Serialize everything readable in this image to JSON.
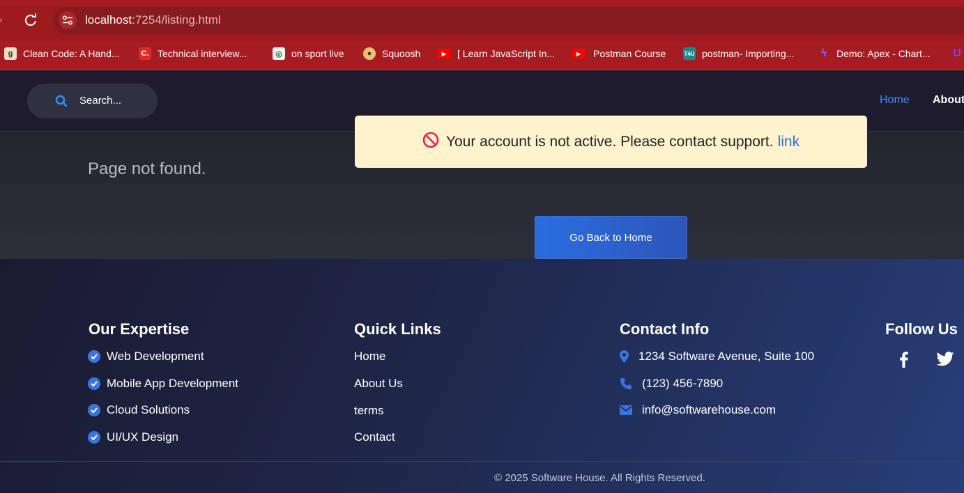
{
  "browser": {
    "url_host": "localhost",
    "url_path": ":7254/listing.html",
    "bookmarks": [
      {
        "label": "Clean Code: A Hand...",
        "icon": "goodreads-icon"
      },
      {
        "label": "Technical interview...",
        "icon": "c-icon"
      },
      {
        "label": "on sport live",
        "icon": "sport-icon"
      },
      {
        "label": "Squoosh",
        "icon": "squoosh-icon"
      },
      {
        "label": "[ Learn JavaScript In...",
        "icon": "youtube-icon"
      },
      {
        "label": "Postman Course",
        "icon": "youtube-icon"
      },
      {
        "label": "postman- Importing...",
        "icon": "t4u-icon"
      },
      {
        "label": "Demo: Apex - Chart...",
        "icon": "apex-icon"
      }
    ]
  },
  "header": {
    "search_placeholder": "Search...",
    "nav": {
      "home": "Home",
      "about": "About"
    },
    "accent_color": "#3f8ff5"
  },
  "alert": {
    "message": "Your account is not active. Please contact support.",
    "link_text": "link"
  },
  "main": {
    "not_found_text": "Page not found.",
    "go_home_label": "Go Back to Home"
  },
  "footer": {
    "expertise": {
      "title": "Our Expertise",
      "items": [
        "Web Development",
        "Mobile App Development",
        "Cloud Solutions",
        "UI/UX Design"
      ]
    },
    "quick_links": {
      "title": "Quick Links",
      "items": [
        "Home",
        "About Us",
        "terms",
        "Contact"
      ]
    },
    "contact": {
      "title": "Contact Info",
      "address": "1234 Software Avenue, Suite 100",
      "phone": "(123) 456-7890",
      "email": "info@softwarehouse.com"
    },
    "follow": {
      "title": "Follow Us",
      "icons": [
        "facebook-icon",
        "twitter-icon"
      ]
    },
    "copyright": "© 2025 Software House. All Rights Reserved."
  }
}
